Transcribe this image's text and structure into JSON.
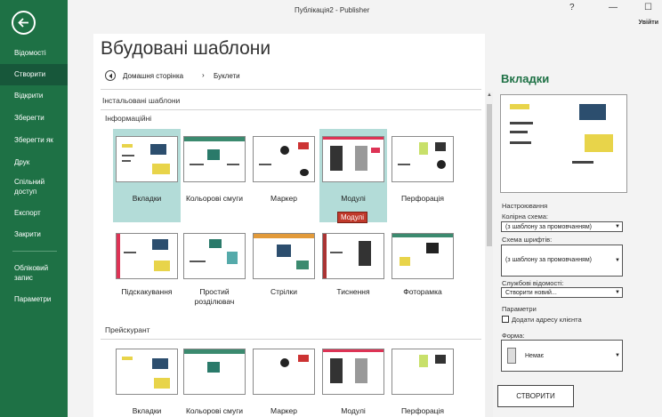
{
  "window": {
    "title": "Публікація2 - Publisher",
    "help": "?",
    "minimize": "—",
    "maximize": "☐",
    "signin": "Увійти"
  },
  "sidebar": {
    "items": [
      {
        "label": "Відомості"
      },
      {
        "label": "Створити"
      },
      {
        "label": "Відкрити"
      },
      {
        "label": "Зберегти"
      },
      {
        "label": "Зберегти як"
      },
      {
        "label": "Друк"
      },
      {
        "label": "Спільний доступ"
      },
      {
        "label": "Експорт"
      },
      {
        "label": "Закрити"
      },
      {
        "label": "Обліковий запис"
      },
      {
        "label": "Параметри"
      }
    ],
    "active_index": 1
  },
  "main": {
    "title": "Вбудовані шаблони",
    "breadcrumb": {
      "home": "Домашня сторінка",
      "separator": "›",
      "current": "Буклети"
    },
    "installed_label": "Інстальовані шаблони",
    "groups": [
      {
        "label": "Інформаційні",
        "rows": [
          [
            "Вкладки",
            "Кольорові смуги",
            "Маркер",
            "Модулі",
            "Перфорація"
          ],
          [
            "Підскакування",
            "Простий розділювач",
            "Стрілки",
            "Тиснення",
            "Фоторамка"
          ]
        ]
      },
      {
        "label": "Прейскурант",
        "rows": [
          [
            "Вкладки",
            "Кольорові смуги",
            "Маркер",
            "Модулі",
            "Перфорація"
          ]
        ]
      }
    ],
    "selected_template": "Вкладки",
    "hover_tooltip": "Модулі"
  },
  "right_pane": {
    "title": "Вкладки",
    "customize_label": "Настроювання",
    "color_scheme_label": "Колірна схема:",
    "color_scheme_value": "(з шаблону за промовчанням)",
    "font_scheme_label": "Схема шрифтів:",
    "font_scheme_value": "(з шаблону за промовчанням)",
    "business_info_label": "Службові відомості:",
    "business_info_value": "Створити новий...",
    "options_label": "Параметри",
    "add_address_label": "Додати адресу клієнта",
    "form_label": "Форма:",
    "form_value": "Немає",
    "create_button": "СТВОРИТИ"
  },
  "colors": {
    "accent_green": "#1e7145",
    "selection_teal": "#b3dcd8",
    "tooltip_red": "#c0392b"
  }
}
